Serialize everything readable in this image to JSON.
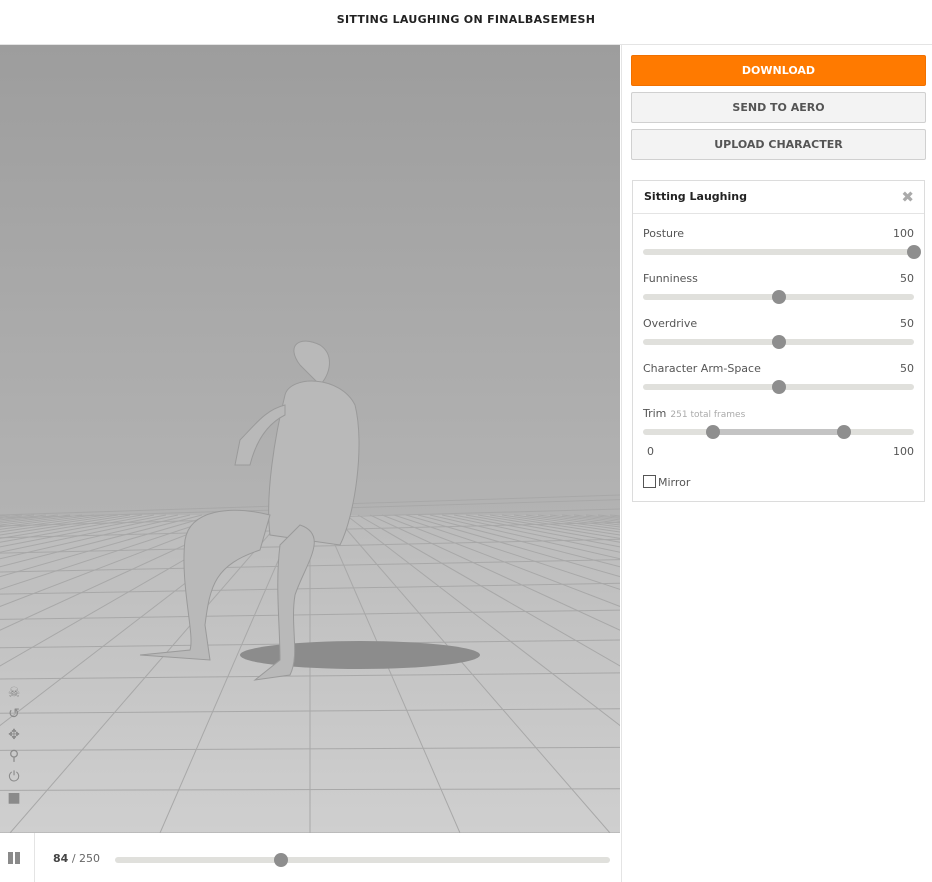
{
  "header": {
    "title": "SITTING LAUGHING ON FINALBASEMESH"
  },
  "actions": {
    "download": "DOWNLOAD",
    "send": "SEND TO AERO",
    "upload": "UPLOAD CHARACTER"
  },
  "colors": {
    "accent": "#ff7a00"
  },
  "panel": {
    "title": "Sitting Laughing",
    "sliders": [
      {
        "label": "Posture",
        "value": "100",
        "pct": 100
      },
      {
        "label": "Funniness",
        "value": "50",
        "pct": 50
      },
      {
        "label": "Overdrive",
        "value": "50",
        "pct": 50
      },
      {
        "label": "Character Arm-Space",
        "value": "50",
        "pct": 50
      }
    ],
    "trim": {
      "label": "Trim",
      "frames": "251 total frames",
      "min_label": "0",
      "max_label": "100",
      "start_pct": 26,
      "end_pct": 74
    },
    "mirror": {
      "label": "Mirror",
      "checked": false
    }
  },
  "viewer_tools": [
    "skull-icon",
    "rotate-icon",
    "move-icon",
    "zoom-icon",
    "power-icon",
    "camera-icon"
  ],
  "playback": {
    "current": "84",
    "total": "/ 250",
    "pct": 33.6
  }
}
